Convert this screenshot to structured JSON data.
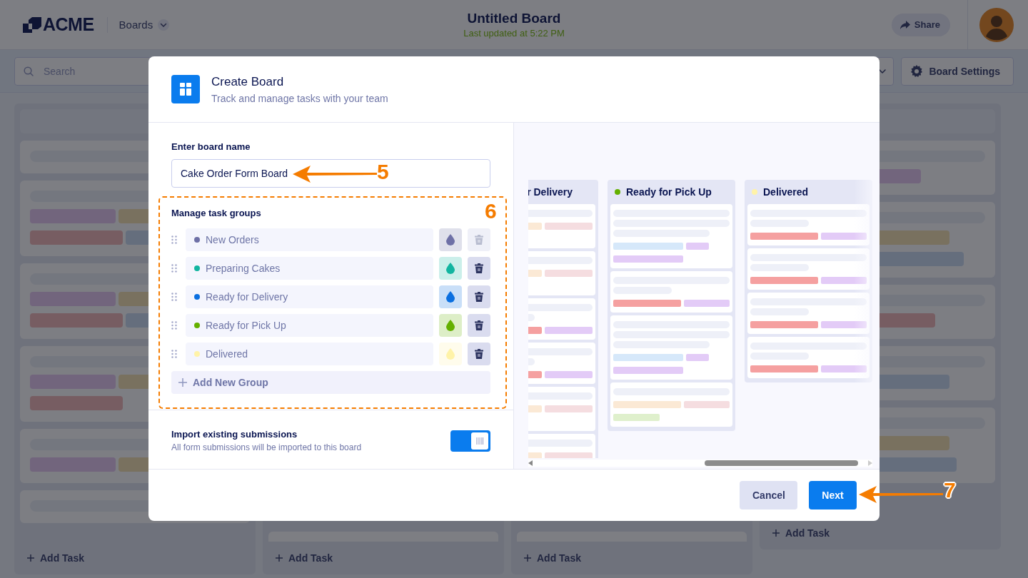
{
  "header": {
    "logo": "ACME",
    "nav": "Boards",
    "title": "Untitled Board",
    "subtitle": "Last updated at 5:22 PM",
    "share": "Share"
  },
  "toolbar": {
    "search_placeholder": "Search",
    "settings": "Board Settings"
  },
  "board": {
    "columns": [
      {
        "add_task": "Add Task"
      },
      {
        "add_task": "Add Task"
      },
      {
        "add_task": "Add Task"
      },
      {
        "add_task": "Add Task"
      }
    ]
  },
  "modal": {
    "title": "Create Board",
    "subtitle": "Track and manage tasks with your team",
    "name_label": "Enter board name",
    "name_value": "Cake Order Form Board",
    "groups_title": "Manage task groups",
    "groups": [
      {
        "name": "New Orders",
        "color": "#6e70a6",
        "disabled": true
      },
      {
        "name": "Preparing Cakes",
        "color": "#12b5a0",
        "disabled": false
      },
      {
        "name": "Ready for Delivery",
        "color": "#0a6fe0",
        "disabled": false
      },
      {
        "name": "Ready for Pick Up",
        "color": "#64b000",
        "disabled": false
      },
      {
        "name": "Delivered",
        "color": "#fff3a8",
        "disabled": false
      }
    ],
    "add_group": "Add New Group",
    "import": {
      "title": "Import existing submissions",
      "description": "All form submissions will be imported to this board",
      "on": true
    },
    "preview": {
      "columns": [
        {
          "title": "r Delivery"
        },
        {
          "title": "Ready for Pick Up",
          "color": "#64b000"
        },
        {
          "title": "Delivered",
          "color": "#fff3a8"
        }
      ]
    },
    "buttons": {
      "cancel": "Cancel",
      "next": "Next"
    }
  },
  "annotations": [
    {
      "kind": "arrow",
      "label": "5"
    },
    {
      "kind": "frame",
      "label": "6"
    },
    {
      "kind": "arrow",
      "label": "7"
    }
  ]
}
